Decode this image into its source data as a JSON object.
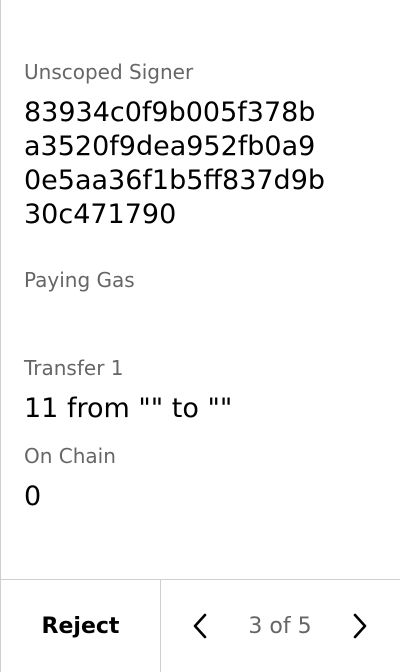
{
  "signer": {
    "label": "Unscoped Signer",
    "lines": [
      "83934c0f9b005f378b",
      "a3520f9dea952fb0a9",
      "0e5aa36f1b5ff837d9b",
      "30c471790"
    ],
    "note": "Paying Gas"
  },
  "transfer": {
    "label": "Transfer 1",
    "value": "11 from \"\" to \"\""
  },
  "chain": {
    "label": "On Chain",
    "value": "0"
  },
  "footer": {
    "reject_label": "Reject",
    "pager_text": "3 of 5",
    "prev_icon": "chevron-left-icon",
    "next_icon": "chevron-right-icon"
  }
}
